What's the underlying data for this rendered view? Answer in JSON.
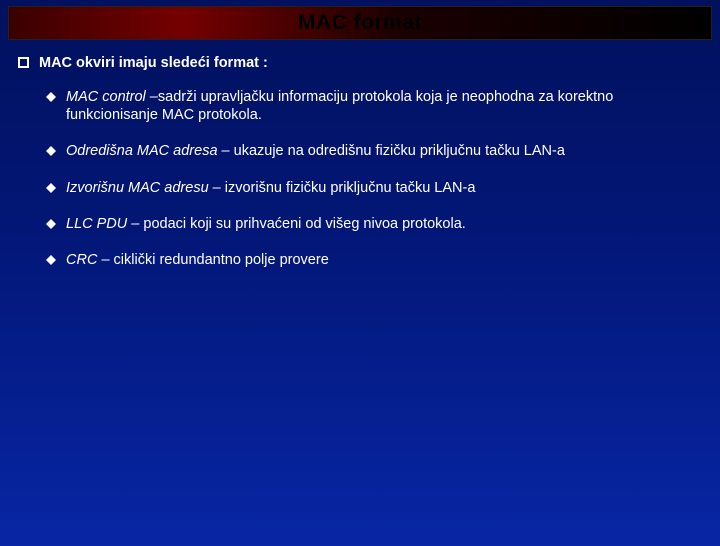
{
  "title": "MAC format",
  "heading": "MAC okviri imaju sledeći format :",
  "items": [
    {
      "term": "MAC control –",
      "desc": "sadrži upravljačku informaciju protokola koja je neophodna za korektno funkcionisanje MAC protokola."
    },
    {
      "term": "Odredišna MAC adresa – ",
      "desc": "ukazuje na odredišnu fizičku priključnu tačku LAN-a"
    },
    {
      "term": "Izvorišnu MAC adresu – ",
      "desc": "izvorišnu fizičku priključnu tačku LAN-a"
    },
    {
      "term": "LLC PDU – ",
      "desc": "podaci koji su prihvaćeni od višeg nivoa protokola."
    },
    {
      "term": "CRC – ",
      "desc": "ciklički redundantno polje provere"
    }
  ]
}
